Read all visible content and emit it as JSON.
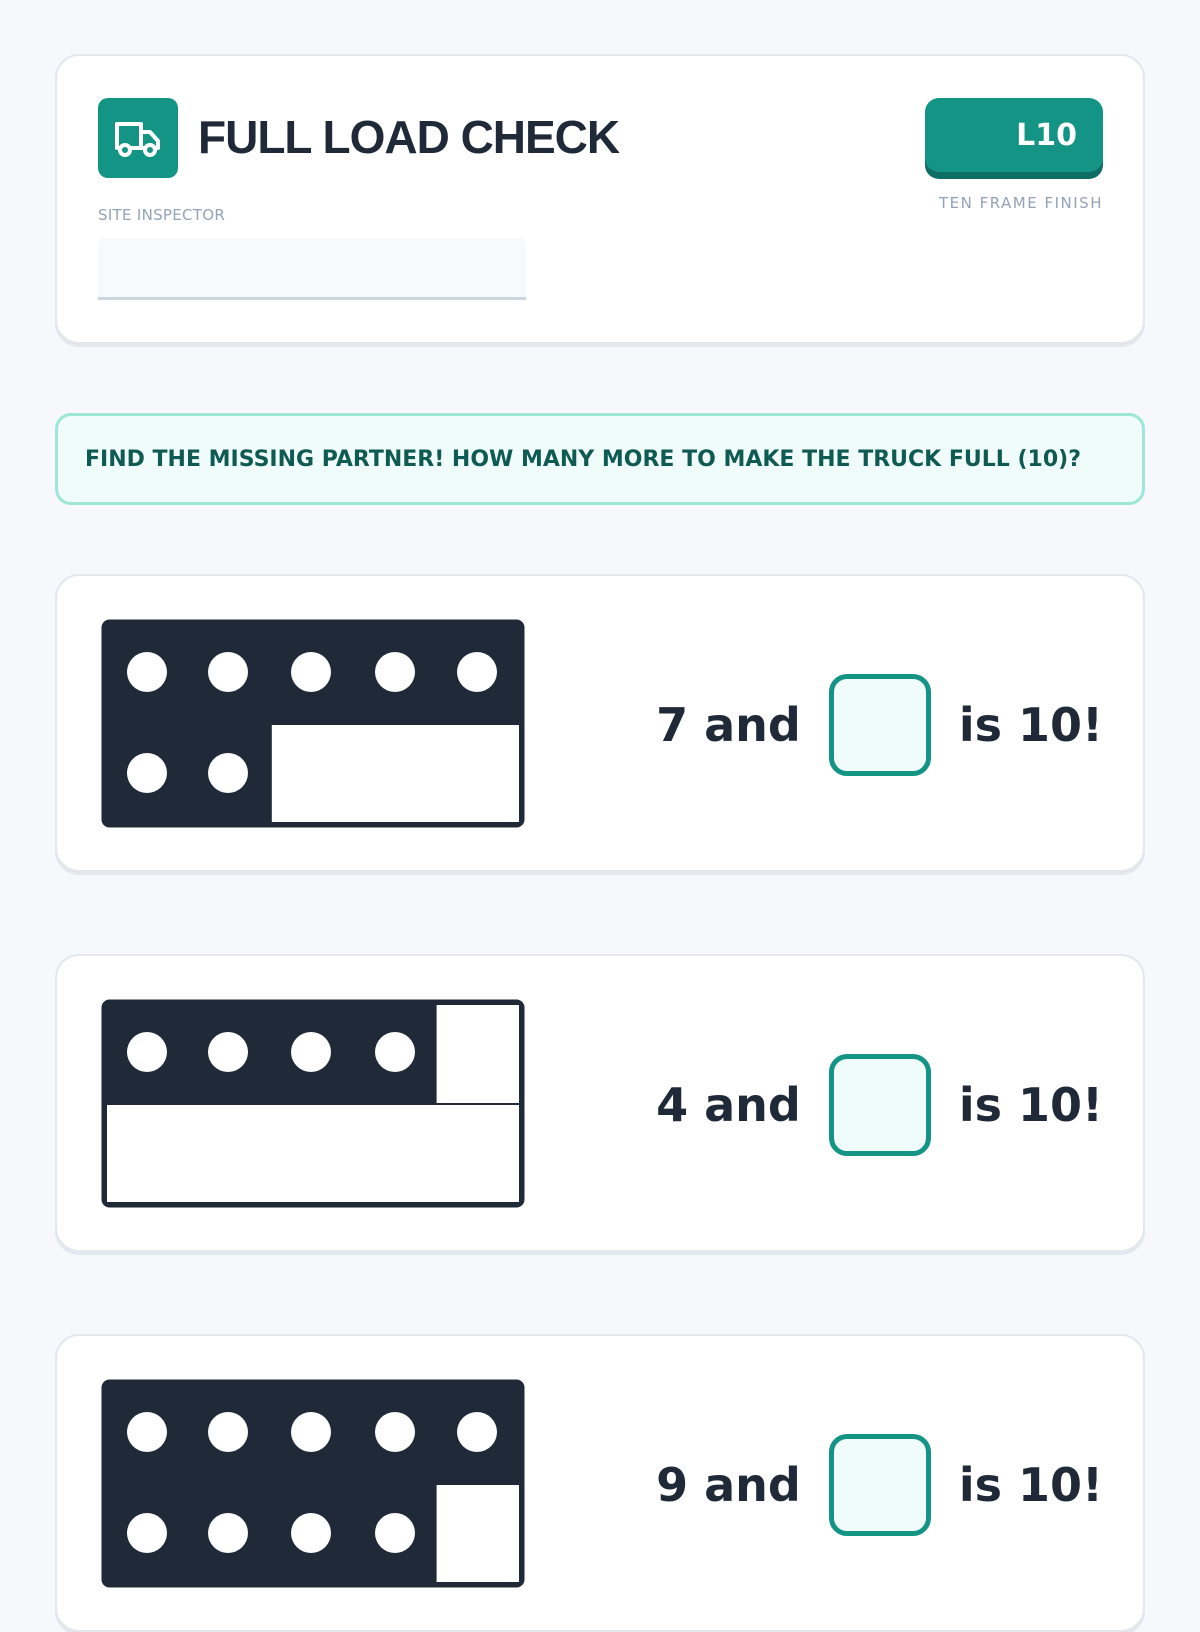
{
  "header": {
    "title": "FULL LOAD CHECK",
    "inspector_label": "SITE INSPECTOR",
    "inspector_value": "",
    "level": "L10",
    "level_subtitle": "TEN FRAME FINISH"
  },
  "instruction": "FIND THE MISSING PARTNER! HOW MANY MORE TO MAKE THE TRUCK FULL (10)?",
  "colors": {
    "accent": "#149484",
    "frame_dark": "#1f2937",
    "answer_fill": "#effcf9"
  },
  "icons": {
    "logo": "truck-icon"
  },
  "problems": [
    {
      "count": 7,
      "prefix": "7 and",
      "suffix": "is 10!",
      "answer": ""
    },
    {
      "count": 4,
      "prefix": "4 and",
      "suffix": "is 10!",
      "answer": ""
    },
    {
      "count": 9,
      "prefix": "9 and",
      "suffix": "is 10!",
      "answer": ""
    }
  ]
}
